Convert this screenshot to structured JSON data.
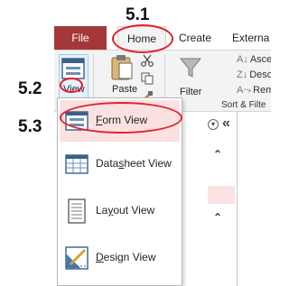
{
  "annotations": {
    "home_step": "5.1",
    "view_step": "5.2",
    "form_step": "5.3"
  },
  "tabs": {
    "file": "File",
    "home": "Home",
    "create": "Create",
    "external": "Externa"
  },
  "ribbon": {
    "view_label": "View",
    "paste_label": "Paste",
    "filter_label": "Filter",
    "ascending": "Ascendi",
    "descending": "Descend",
    "remove": "Remove",
    "group_label": "Sort & Filte"
  },
  "nav": {
    "close_glyph": "«",
    "collapse_glyph": "⌃"
  },
  "dropdown": {
    "items": [
      {
        "label": "Form View",
        "accel": "F",
        "rest": "orm View"
      },
      {
        "label": "Datasheet View",
        "pre": "Data",
        "accel": "s",
        "rest": "heet View"
      },
      {
        "label": "Layout View",
        "pre": "La",
        "accel": "y",
        "rest": "out View"
      },
      {
        "label": "Design View",
        "accel": "D",
        "rest": "esign View"
      }
    ]
  },
  "colors": {
    "file_tab": "#a4373a",
    "annotation_red": "#e2202c",
    "selected_item": "#fbe1e1"
  }
}
